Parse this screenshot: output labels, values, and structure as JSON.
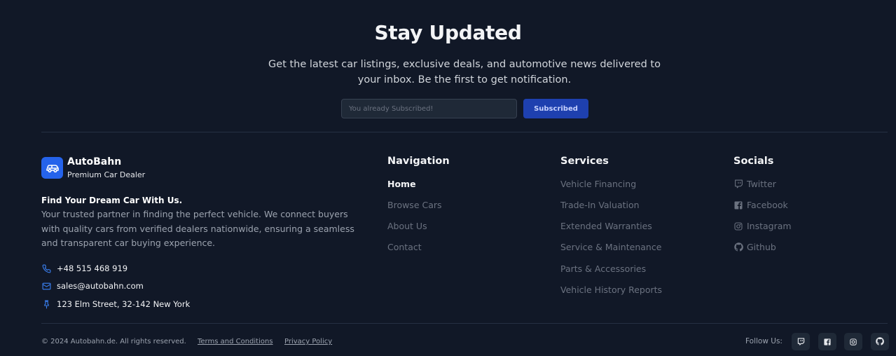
{
  "newsletter": {
    "title": "Stay Updated",
    "description": "Get the latest car listings, exclusive deals, and automotive news delivered to your inbox. Be the first to get notification.",
    "input_placeholder": "You already Subscribed!",
    "button_label": "Subscribed"
  },
  "brand": {
    "name": "AutoBahn",
    "subtitle": "Premium Car Dealer",
    "logo_icon": "car-icon",
    "tagline": "Find Your Dream Car With Us.",
    "about": "Your trusted partner in finding the perfect vehicle. We connect buyers with quality cars from verified dealers nationwide, ensuring a seamless and transparent car buying experience.",
    "contact": {
      "phone": "+48 515 468 919",
      "email": "sales@autobahn.com",
      "address": "123 Elm Street, 32-142 New York"
    }
  },
  "navigation": {
    "title": "Navigation",
    "items": [
      "Home",
      "Browse Cars",
      "About Us",
      "Contact"
    ]
  },
  "services": {
    "title": "Services",
    "items": [
      "Vehicle Financing",
      "Trade-In Valuation",
      "Extended Warranties",
      "Service & Maintenance",
      "Parts & Accessories",
      "Vehicle History Reports"
    ]
  },
  "socials": {
    "title": "Socials",
    "items": [
      {
        "label": "Twitter",
        "icon": "twitch-icon"
      },
      {
        "label": "Facebook",
        "icon": "facebook-icon"
      },
      {
        "label": "Instagram",
        "icon": "instagram-icon"
      },
      {
        "label": "Github",
        "icon": "github-icon"
      }
    ]
  },
  "footer": {
    "copyright": "© 2024 Autobahn.de. All rights reserved.",
    "terms": "Terms and Conditions",
    "privacy": "Privacy Policy",
    "follow_label": "Follow Us:"
  },
  "colors": {
    "background": "#111827",
    "accent": "#2563eb",
    "button": "#1e40af"
  }
}
